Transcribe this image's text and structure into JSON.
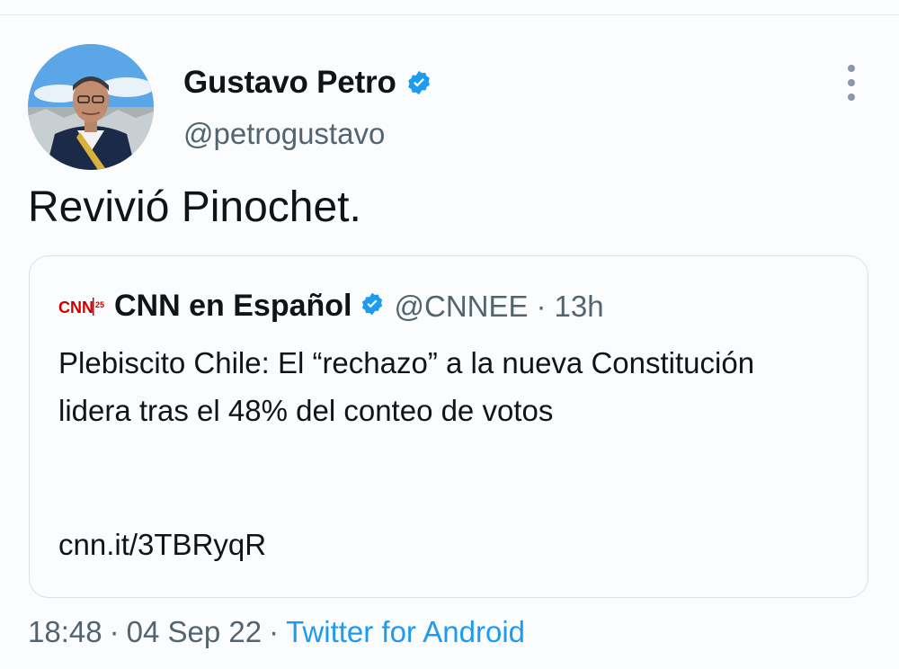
{
  "author": {
    "name": "Gustavo Petro",
    "handle": "@petrogustavo",
    "verified": true
  },
  "tweet": {
    "text": "Revivió Pinochet."
  },
  "quoted": {
    "logo_text": "CNN",
    "logo_badge": "25",
    "name": "CNN en Español",
    "handle": "@CNNEE",
    "separator": "·",
    "time": "13h",
    "text": "Plebiscito Chile: El “rechazo” a la nueva Constitución lidera tras el 48% del conteo de votos",
    "link": "cnn.it/3TBRyqR"
  },
  "meta": {
    "time": "18:48",
    "separator": "·",
    "date": "04 Sep 22",
    "source": "Twitter for Android"
  },
  "colors": {
    "verified": "#1d9bf0",
    "secondary_text": "#536471",
    "link_source": "#1d9bf0",
    "cnn_red": "#cc0000"
  },
  "icons": {
    "verified": "verified-badge-icon",
    "more": "more-vertical-icon"
  }
}
